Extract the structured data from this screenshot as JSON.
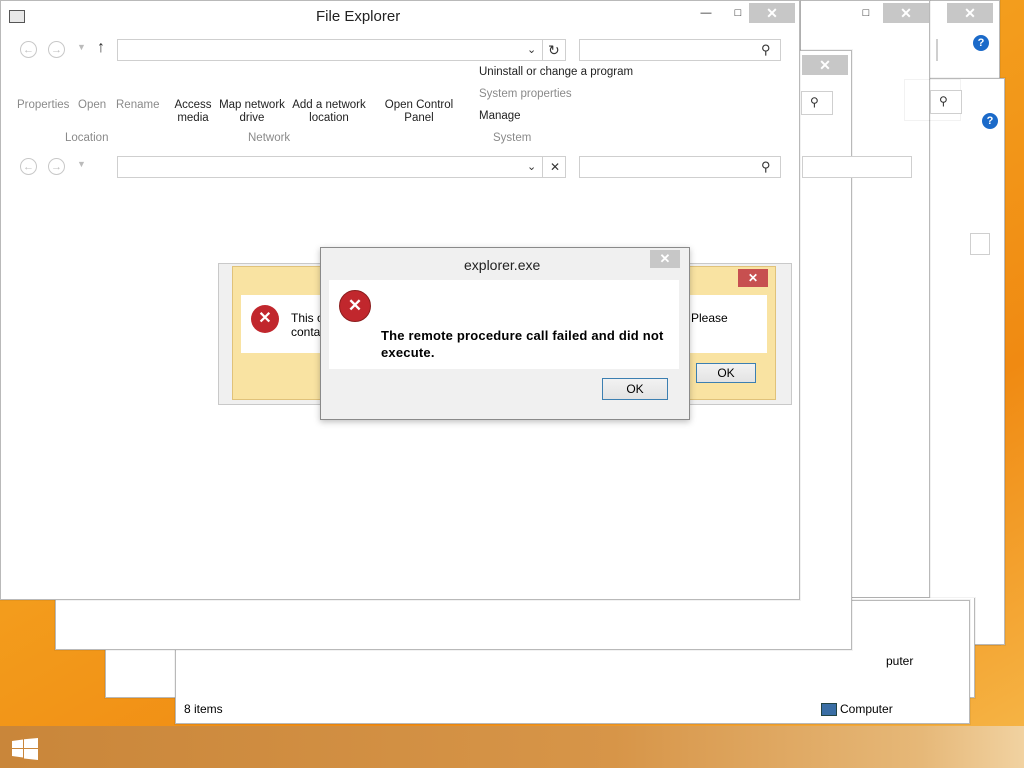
{
  "main_window": {
    "title": "File Explorer",
    "ribbon": {
      "location_items": [
        "Properties",
        "Open",
        "Rename"
      ],
      "network_items": [
        "Access\nmedia",
        "Map network\ndrive",
        "Add a network\nlocation",
        "Open Control\nPanel"
      ],
      "system_items": [
        "Uninstall or change a program",
        "System properties",
        "Manage"
      ],
      "group_labels": {
        "location": "Location",
        "network": "Network",
        "system": "System"
      }
    }
  },
  "back_window": {
    "status_items": "8 items",
    "status_computer": "Computer",
    "status_computer_2": "puter"
  },
  "middle_dialog": {
    "text_line1": "This o",
    "text_line2": "contac",
    "text_right": "Please",
    "ok_label": "OK"
  },
  "error_dialog": {
    "title": "explorer.exe",
    "message": "The remote procedure call failed and did not execute.",
    "ok_label": "OK"
  },
  "icons": {
    "error": "error-icon",
    "help": "help-icon",
    "search": "search-icon",
    "refresh": "refresh-icon",
    "windows": "windows-logo-icon"
  },
  "colors": {
    "desktop": "#f39c1c",
    "close_red": "#c75050",
    "error_red": "#c1272d",
    "help_blue": "#1b6ac9"
  }
}
